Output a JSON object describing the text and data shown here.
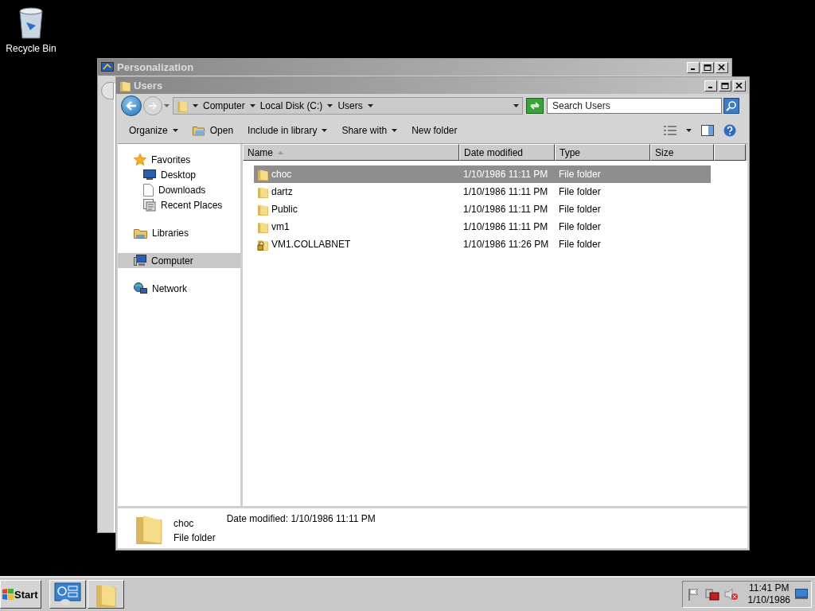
{
  "desktop_icons": [
    {
      "label": "Recycle Bin"
    }
  ],
  "background_window": {
    "title": "Personalization"
  },
  "window": {
    "title": "Users",
    "address": {
      "breadcrumbs": [
        "Computer",
        "Local Disk (C:)",
        "Users"
      ]
    },
    "search": {
      "placeholder": "Search Users"
    },
    "toolbar": [
      {
        "label": "Organize",
        "kind": "menu"
      },
      {
        "label": "Open",
        "kind": "open"
      },
      {
        "label": "Include in library",
        "kind": "menu"
      },
      {
        "label": "Share with",
        "kind": "menu"
      },
      {
        "label": "New folder",
        "kind": "plain"
      }
    ],
    "nav": [
      {
        "label": "Favorites",
        "kind": "star",
        "selected": false,
        "children": [
          {
            "label": "Desktop",
            "kind": "desktop",
            "selected": false
          },
          {
            "label": "Downloads",
            "kind": "document",
            "selected": false
          },
          {
            "label": "Recent Places",
            "kind": "recent",
            "selected": false
          }
        ]
      },
      {
        "label": "Libraries",
        "kind": "library",
        "selected": false
      },
      {
        "label": "Computer",
        "kind": "computer",
        "selected": true
      },
      {
        "label": "Network",
        "kind": "network",
        "selected": false
      }
    ],
    "columns": [
      {
        "label": "Name",
        "sorted": true
      },
      {
        "label": "Date modified",
        "sorted": false
      },
      {
        "label": "Type",
        "sorted": false
      },
      {
        "label": "Size",
        "sorted": false
      }
    ],
    "rows": [
      {
        "name": "choc",
        "date_modified": "1/10/1986 11:11 PM",
        "type": "File folder",
        "kind": "folder",
        "selected": true
      },
      {
        "name": "dartz",
        "date_modified": "1/10/1986 11:11 PM",
        "type": "File folder",
        "kind": "folder",
        "selected": false
      },
      {
        "name": "Public",
        "date_modified": "1/10/1986 11:11 PM",
        "type": "File folder",
        "kind": "folder",
        "selected": false
      },
      {
        "name": "vm1",
        "date_modified": "1/10/1986 11:11 PM",
        "type": "File folder",
        "kind": "folder",
        "selected": false
      },
      {
        "name": "VM1.COLLABNET",
        "date_modified": "1/10/1986 11:26 PM",
        "type": "File folder",
        "kind": "locked-folder",
        "selected": false
      }
    ],
    "details": {
      "name": "choc",
      "date_modified": "Date modified: 1/10/1986 11:11 PM",
      "type": "File folder"
    }
  },
  "taskbar": {
    "start": "Start",
    "buttons": [
      {
        "kind": "control-panel"
      },
      {
        "kind": "folder"
      }
    ],
    "clock": {
      "time": "11:41 PM",
      "date": "1/10/1986"
    }
  }
}
